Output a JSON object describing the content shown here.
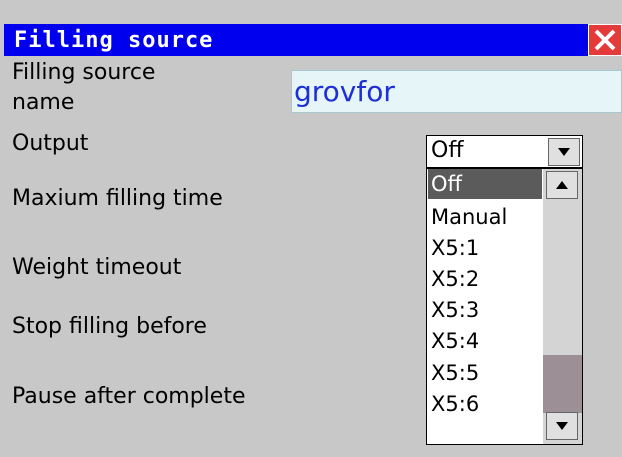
{
  "window": {
    "title": "Filling source"
  },
  "fields": {
    "name_label_line1": "Filling source",
    "name_label_line2": "name",
    "name_value": "grovfor",
    "output_label": "Output",
    "max_time_label": "Maxium filling time",
    "weight_timeout_label": "Weight timeout",
    "stop_before_label": "Stop filling before",
    "pause_label": "Pause after complete"
  },
  "output_select": {
    "selected": "Off",
    "options": [
      "Off",
      "Manual",
      "X5:1",
      "X5:2",
      "X5:3",
      "X5:4",
      "X5:5",
      "X5:6"
    ],
    "highlighted_index": 0
  },
  "colors": {
    "titlebar": "#0000ee",
    "close": "#e43a3a",
    "input_text": "#1d2fd8"
  },
  "icons": [
    "close-icon",
    "chevron-down-icon",
    "chevron-up-icon"
  ]
}
